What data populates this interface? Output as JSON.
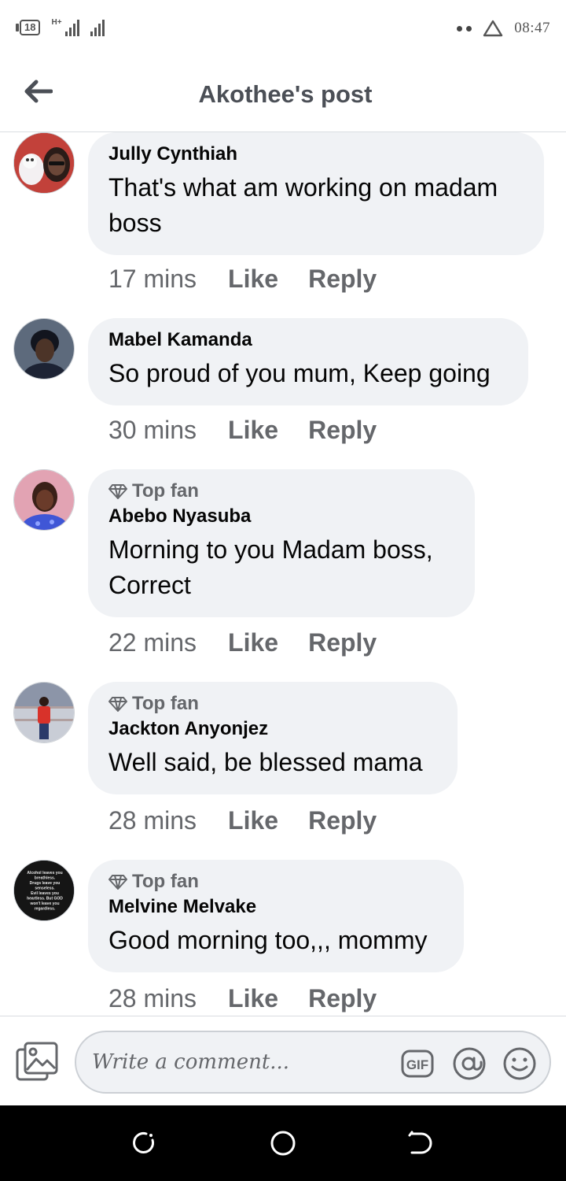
{
  "status_bar": {
    "battery": "18",
    "network": "H+",
    "time": "08:47"
  },
  "header": {
    "title": "Akothee's post"
  },
  "comments": [
    {
      "author": "Jully Cynthiah",
      "top_fan": false,
      "text_lines": [
        "That's what am working on madam",
        "boss"
      ],
      "time": "17 mins",
      "like": "Like",
      "reply": "Reply"
    },
    {
      "author": "Mabel Kamanda",
      "top_fan": false,
      "text_lines": [
        "So proud of you mum, Keep going"
      ],
      "time": "30 mins",
      "like": "Like",
      "reply": "Reply"
    },
    {
      "author": "Abebo Nyasuba",
      "top_fan": true,
      "badge": "Top fan",
      "text_lines": [
        "Morning to you Madam boss,",
        "Correct"
      ],
      "time": "22 mins",
      "like": "Like",
      "reply": "Reply"
    },
    {
      "author": "Jackton Anyonjez",
      "top_fan": true,
      "badge": "Top fan",
      "text_lines": [
        "Well said, be blessed mama"
      ],
      "time": "28 mins",
      "like": "Like",
      "reply": "Reply"
    },
    {
      "author": "Melvine Melvake",
      "top_fan": true,
      "badge": "Top fan",
      "text_lines": [
        "Good morning too,,, mommy"
      ],
      "time": "28 mins",
      "like": "Like",
      "reply": "Reply",
      "avatar_text": [
        "Alcohol leaves you",
        "breathless.",
        "Drugs leave you",
        "senseless.",
        "Evil leaves you",
        "heartless. But GOD",
        "won't leave you",
        "regardless."
      ]
    }
  ],
  "composer": {
    "placeholder": "Write a comment...",
    "gif_label": "GIF"
  },
  "colors": {
    "bubble": "#f0f2f5",
    "muted_text": "#65676b",
    "title_text": "#4b4f56"
  },
  "icons": {
    "back": "back-arrow-icon",
    "photo": "photo-icon",
    "gif": "gif-icon",
    "mention": "at-icon",
    "emoji": "emoji-icon",
    "top_fan": "diamond-icon"
  }
}
